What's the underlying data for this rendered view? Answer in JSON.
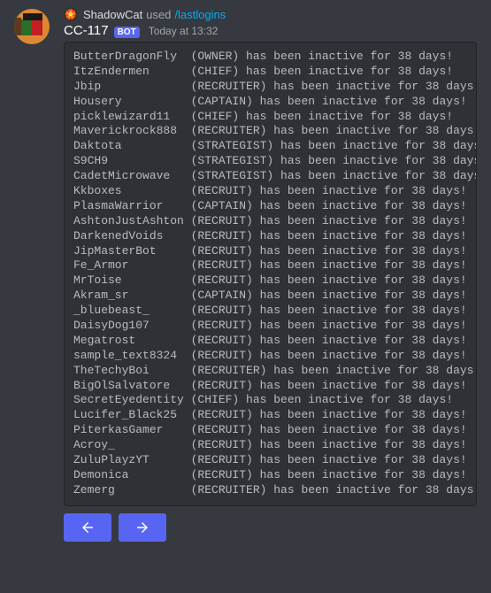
{
  "reply": {
    "avatar_emoji": "🏵️",
    "username": "ShadowCat",
    "used_text": "used",
    "command": "/lastlogins"
  },
  "message": {
    "username": "CC-117",
    "bot_label": "BOT",
    "timestamp": "Today at 13:32"
  },
  "buttons": {
    "prev": "←",
    "next": "→"
  },
  "members": [
    {
      "name": "ButterDragonFly",
      "role": "OWNER",
      "days": 38
    },
    {
      "name": "ItzEndermen",
      "role": "CHIEF",
      "days": 38
    },
    {
      "name": "Jbip",
      "role": "RECRUITER",
      "days": 38
    },
    {
      "name": "Housery",
      "role": "CAPTAIN",
      "days": 38
    },
    {
      "name": "picklewizard11",
      "role": "CHIEF",
      "days": 38
    },
    {
      "name": "Maverickrock888",
      "role": "RECRUITER",
      "days": 38
    },
    {
      "name": "Daktota",
      "role": "STRATEGIST",
      "days": 38
    },
    {
      "name": "S9CH9",
      "role": "STRATEGIST",
      "days": 38
    },
    {
      "name": "CadetMicrowave",
      "role": "STRATEGIST",
      "days": 38
    },
    {
      "name": "Kkboxes",
      "role": "RECRUIT",
      "days": 38
    },
    {
      "name": "PlasmaWarrior",
      "role": "CAPTAIN",
      "days": 38
    },
    {
      "name": "AshtonJustAshton",
      "role": "RECRUIT",
      "days": 38
    },
    {
      "name": "DarkenedVoids",
      "role": "RECRUIT",
      "days": 38
    },
    {
      "name": "JipMasterBot",
      "role": "RECRUIT",
      "days": 38
    },
    {
      "name": "Fe_Armor",
      "role": "RECRUIT",
      "days": 38
    },
    {
      "name": "MrToise",
      "role": "RECRUIT",
      "days": 38
    },
    {
      "name": "Akram_sr",
      "role": "CAPTAIN",
      "days": 38
    },
    {
      "name": "_bluebeast_",
      "role": "RECRUIT",
      "days": 38
    },
    {
      "name": "DaisyDog107",
      "role": "RECRUIT",
      "days": 38
    },
    {
      "name": "Megatrost",
      "role": "RECRUIT",
      "days": 38
    },
    {
      "name": "sample_text8324",
      "role": "RECRUIT",
      "days": 38
    },
    {
      "name": "TheTechyBoi",
      "role": "RECRUITER",
      "days": 38
    },
    {
      "name": "BigOlSalvatore",
      "role": "RECRUIT",
      "days": 38
    },
    {
      "name": "SecretEyedentity",
      "role": "CHIEF",
      "days": 38
    },
    {
      "name": "Lucifer_Black25",
      "role": "RECRUIT",
      "days": 38
    },
    {
      "name": "PiterkasGamer",
      "role": "RECRUIT",
      "days": 38
    },
    {
      "name": "Acroy_",
      "role": "RECRUIT",
      "days": 38
    },
    {
      "name": "ZuluPlayzYT",
      "role": "RECRUIT",
      "days": 38
    },
    {
      "name": "Demonica",
      "role": "RECRUIT",
      "days": 38
    },
    {
      "name": "Zemerg",
      "role": "RECRUITER",
      "days": 38
    }
  ]
}
